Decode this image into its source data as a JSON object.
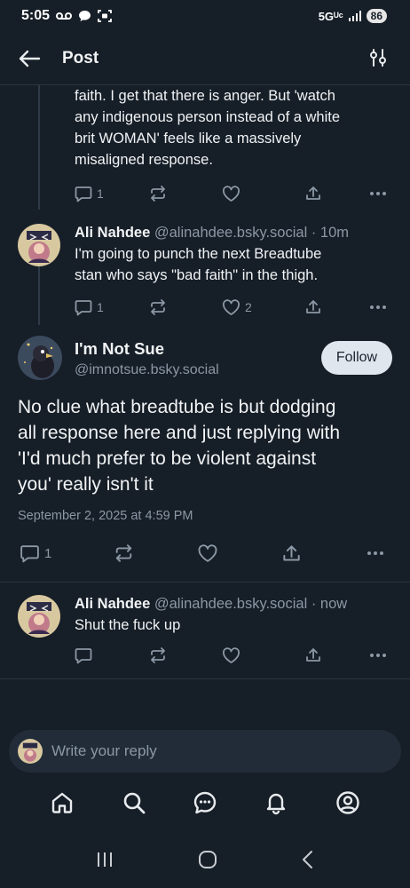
{
  "status_bar": {
    "time": "5:05",
    "network": "5Gᵁᶜ",
    "battery": "86"
  },
  "header": {
    "title": "Post"
  },
  "posts": {
    "first": {
      "text_lines": [
        "faith. I get that there is anger. But 'watch",
        "any indigenous person instead of a white",
        "brit WOMAN' feels like a massively",
        "misaligned response."
      ],
      "reply_count": "1"
    },
    "second": {
      "name": "Ali Nahdee",
      "handle": "@alinahdee.bsky.social",
      "time": "· 10m",
      "text_lines": [
        "I'm going to punch the next Breadtube",
        "stan who says \"bad faith\" in the thigh."
      ],
      "reply_count": "1",
      "like_count": "2"
    },
    "main": {
      "name": "I'm Not Sue",
      "handle": "@imnotsue.bsky.social",
      "follow_label": "Follow",
      "text_lines": [
        "No clue what breadtube is but dodging",
        "all response here and just replying with",
        "'I'd much prefer to be violent against",
        "you' really isn't it"
      ],
      "date": "September 2, 2025 at 4:59 PM",
      "reply_count": "1"
    },
    "last": {
      "name": "Ali Nahdee",
      "handle": "@alinahdee.bsky.social",
      "time": "· now",
      "text": "Shut the fuck up"
    }
  },
  "reply_bar": {
    "placeholder": "Write your reply"
  },
  "colors": {
    "background": "#161e27",
    "muted": "#8b98a5",
    "text": "#f1f3f5",
    "follow_bg": "#dfe6ee"
  },
  "nav_icons": [
    "home-icon",
    "search-icon",
    "chat-icon",
    "bell-icon",
    "profile-icon"
  ]
}
